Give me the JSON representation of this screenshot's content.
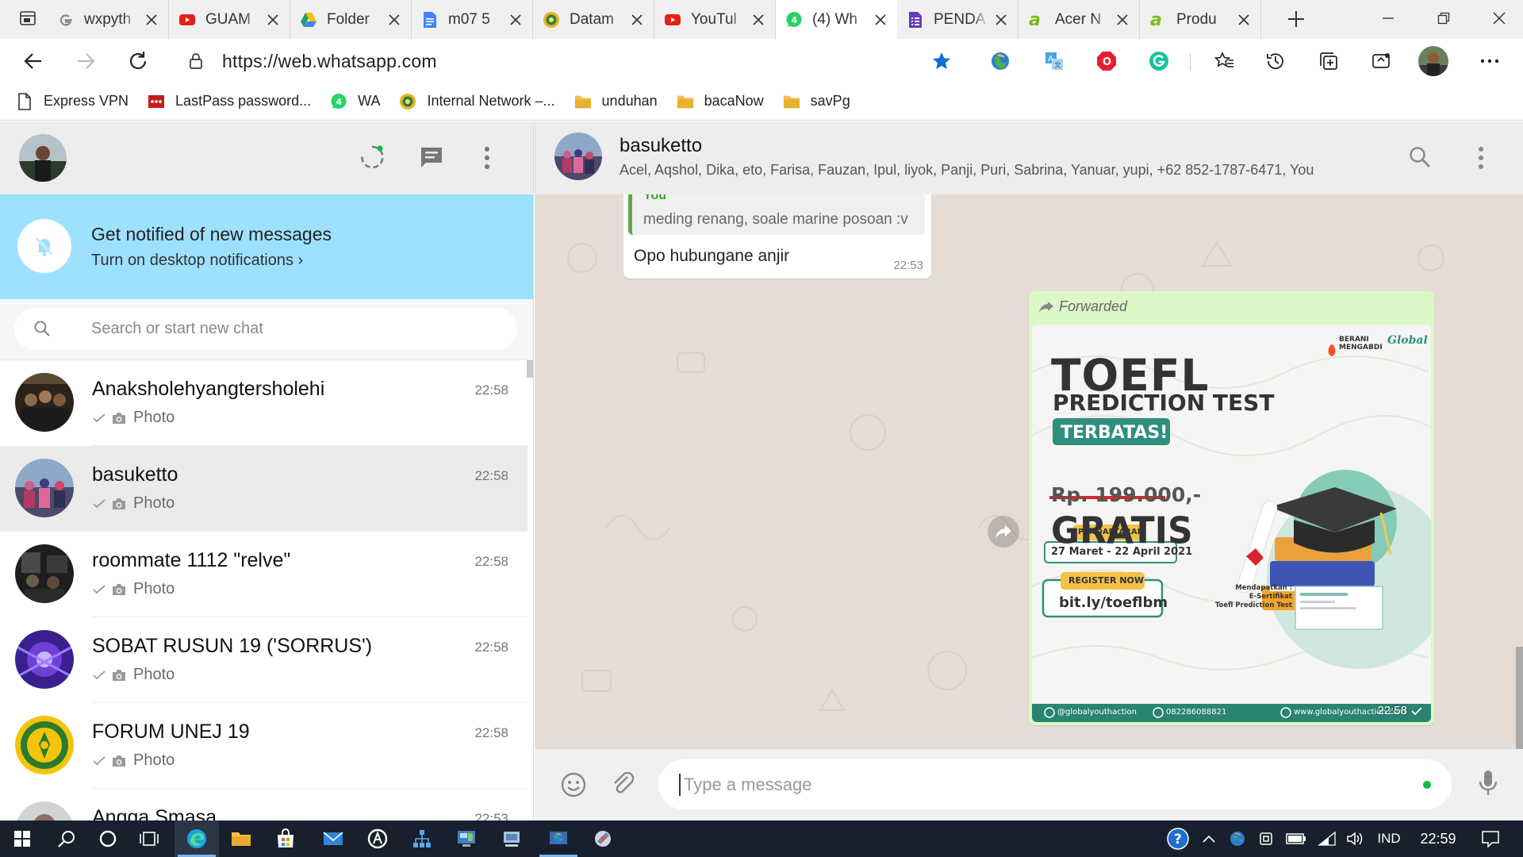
{
  "browser": {
    "tabs": [
      {
        "title": "wxpyth",
        "icon": "google-icon"
      },
      {
        "title": "GUAM",
        "icon": "youtube-icon"
      },
      {
        "title": "Folder",
        "icon": "drive-icon"
      },
      {
        "title": "m07 5",
        "icon": "docs-icon"
      },
      {
        "title": "Datam",
        "icon": "site-icon"
      },
      {
        "title": "YouTul",
        "icon": "youtube-icon"
      },
      {
        "title": "(4) Wh",
        "icon": "whatsapp-icon"
      },
      {
        "title": "PENDA",
        "icon": "forms-icon"
      },
      {
        "title": "Acer N",
        "icon": "acer-icon"
      },
      {
        "title": "Produ",
        "icon": "acer-icon"
      }
    ],
    "active_tab_index": 6,
    "url": "https://web.whatsapp.com",
    "bookmarks": [
      {
        "label": "Express VPN",
        "icon": "page-icon"
      },
      {
        "label": "LastPass password...",
        "icon": "lastpass-icon"
      },
      {
        "label": "WA",
        "icon": "whatsapp-icon"
      },
      {
        "label": "Internal Network –...",
        "icon": "site-icon"
      },
      {
        "label": "unduhan",
        "icon": "folder-icon"
      },
      {
        "label": "bacaNow",
        "icon": "folder-icon"
      },
      {
        "label": "savPg",
        "icon": "folder-icon"
      }
    ],
    "accent": "#0078d4"
  },
  "whatsapp": {
    "notification": {
      "title": "Get notified of new messages",
      "link": "Turn on desktop notifications ›"
    },
    "search_placeholder": "Search or start new chat",
    "chats": [
      {
        "name": "Anaksholehyangtersholehi",
        "time": "22:58",
        "preview": "Photo"
      },
      {
        "name": "basuketto",
        "time": "22:58",
        "preview": "Photo",
        "selected": true
      },
      {
        "name": "roommate 1112 \"relve\"",
        "time": "22:58",
        "preview": "Photo"
      },
      {
        "name": "SOBAT RUSUN 19 ('SORRUS')",
        "time": "22:58",
        "preview": "Photo"
      },
      {
        "name": "FORUM UNEJ 19",
        "time": "22:58",
        "preview": "Photo"
      },
      {
        "name": "Angga Smasa",
        "time": "22:53",
        "preview": ""
      }
    ],
    "conversation": {
      "name": "basuketto",
      "members": "Acel, Aqshol, Dika, eto, Farisa, Fauzan, Ipul, liyok, Panji, Puri, Sabrina, Yanuar, yupi, +62 852-1787-6471, You",
      "incoming": {
        "quote_author": "You",
        "quote_text": "meding renang, soale marine posoan :v",
        "text": "Opo hubungane anjir",
        "time": "22:53"
      },
      "outgoing": {
        "forwarded_label": "Forwarded",
        "time": "22:58",
        "poster": {
          "brand1": "BERANI MENGABDI",
          "brand2": "Global",
          "title1": "TOEFL",
          "title2": "PREDICTION TEST",
          "badge": "TERBATAS!",
          "old_price": "Rp. 199.000,-",
          "free": "GRATIS",
          "reg_label": "PENDAFTARAN",
          "dates": "27 Maret - 22 April 2021",
          "register": "REGISTER NOW",
          "link": "bit.ly/toeflbm",
          "cert1": "Mendapatkan :",
          "cert2": "E-Sertifikat",
          "cert3": "Toefl Prediction Test",
          "ig": "@globalyouthaction",
          "phone": "082286088821",
          "web": "www.globalyouthaction.com"
        }
      },
      "input_placeholder": "Type a message"
    },
    "colors": {
      "notification_bg": "#9de1fe",
      "wallpaper": "#e5ddd5",
      "outgoing_bubble": "#dcf8c6",
      "poster_teal": "#2f8f7f",
      "poster_red": "#d7262b"
    }
  },
  "taskbar": {
    "language": "IND",
    "clock": "22:59",
    "bg": "#18202d"
  }
}
